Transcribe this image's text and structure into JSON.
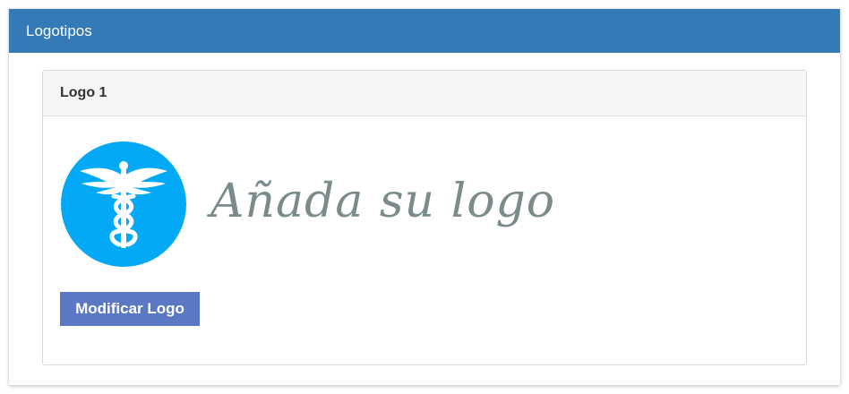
{
  "panel": {
    "title": "Logotipos"
  },
  "logo_card": {
    "title": "Logo 1",
    "logo": {
      "icon": "caduceus-icon",
      "text": "Añada su logo",
      "circle_color": "#03a9f4",
      "text_color": "#7a8b8b"
    },
    "button_label": "Modificar Logo"
  },
  "colors": {
    "header_bg": "#337ab7",
    "button_bg": "#5b78c4",
    "card_header_bg": "#f5f5f5"
  }
}
